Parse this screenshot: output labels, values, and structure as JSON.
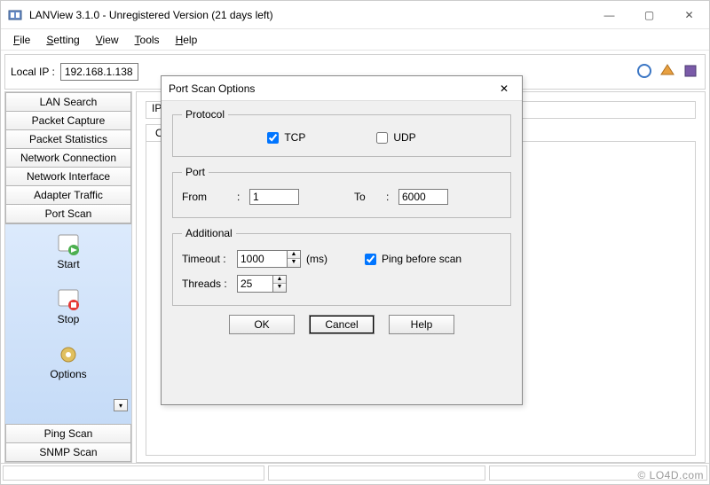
{
  "window": {
    "title": "LANView 3.1.0 - Unregistered Version (21 days left)",
    "controls": {
      "min": "—",
      "max": "▢",
      "close": "✕"
    }
  },
  "menubar": [
    "File",
    "Setting",
    "View",
    "Tools",
    "Help"
  ],
  "toolbar": {
    "local_ip_label": "Local IP :",
    "local_ip_value": "192.168.1.138"
  },
  "sidebar": {
    "buttons": [
      "LAN Search",
      "Packet Capture",
      "Packet Statistics",
      "Network Connection",
      "Network Interface",
      "Adapter Traffic",
      "Port Scan"
    ],
    "actions": [
      "Start",
      "Stop",
      "Options"
    ],
    "bottom_buttons": [
      "Ping Scan",
      "SNMP Scan"
    ],
    "more": "▾"
  },
  "main": {
    "ip_label": "IP",
    "tab_label": "Op"
  },
  "dialog": {
    "title": "Port Scan Options",
    "close": "✕",
    "protocol": {
      "legend": "Protocol",
      "tcp_label": "TCP",
      "tcp_checked": true,
      "udp_label": "UDP",
      "udp_checked": false
    },
    "port": {
      "legend": "Port",
      "from_label": "From",
      "from_value": "1",
      "to_label": "To",
      "to_value": "6000"
    },
    "additional": {
      "legend": "Additional",
      "timeout_label": "Timeout :",
      "timeout_value": "1000",
      "timeout_unit": "(ms)",
      "ping_label": "Ping before scan",
      "ping_checked": true,
      "threads_label": "Threads :",
      "threads_value": "25"
    },
    "buttons": {
      "ok": "OK",
      "cancel": "Cancel",
      "help": "Help"
    }
  },
  "watermark": "© LO4D.com"
}
